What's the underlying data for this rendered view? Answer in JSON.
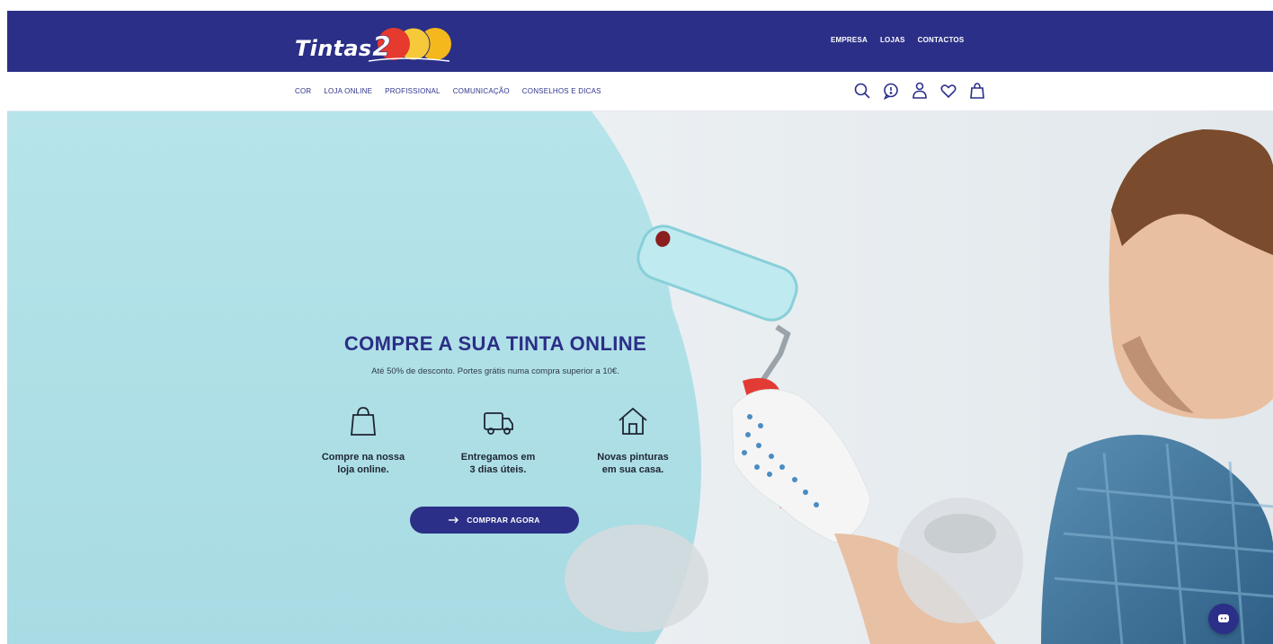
{
  "brand": {
    "name": "Tintas",
    "logo_mark": "200",
    "primary_color": "#2b2f87"
  },
  "top_links": [
    "EMPRESA",
    "LOJAS",
    "CONTACTOS"
  ],
  "nav": {
    "links": [
      "COR",
      "LOJA ONLINE",
      "PROFISSIONAL",
      "COMUNICAÇÃO",
      "CONSELHOS E DICAS"
    ],
    "icons": [
      "search-icon",
      "chat-bubble-icon",
      "user-icon",
      "heart-icon",
      "shopping-bag-icon"
    ]
  },
  "hero": {
    "title": "COMPRE A SUA TINTA ONLINE",
    "subtitle": "Até 50% de desconto. Portes grátis numa compra superior a 10€.",
    "features": [
      {
        "icon": "shopping-bag-icon",
        "line1": "Compre na nossa",
        "line2": "loja online."
      },
      {
        "icon": "delivery-truck-icon",
        "line1": "Entregamos em",
        "line2": "3 dias úteis."
      },
      {
        "icon": "house-icon",
        "line1": "Novas pinturas",
        "line2": "em sua casa."
      }
    ],
    "cta_label": "COMPRAR AGORA",
    "cta_icon": "arrow-right-icon"
  },
  "chat_widget": {
    "icon": "chat-icon"
  }
}
